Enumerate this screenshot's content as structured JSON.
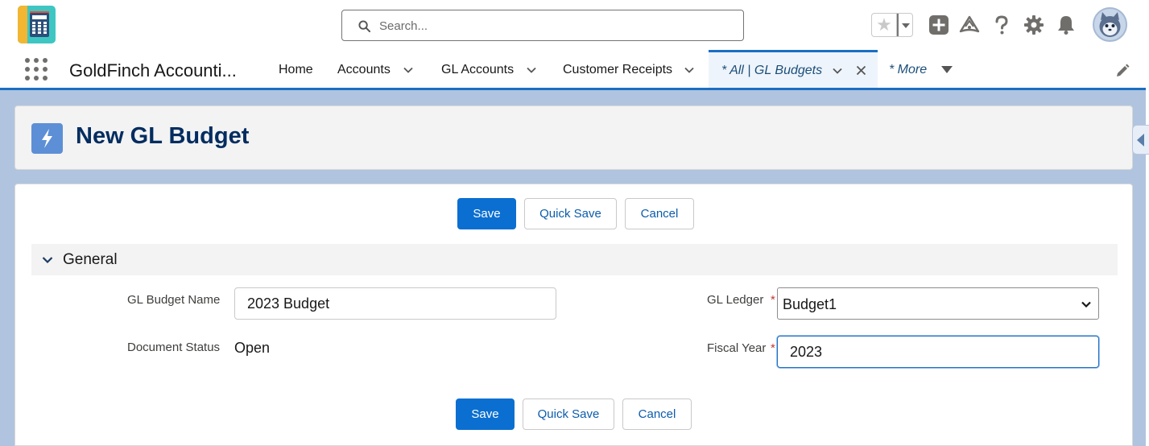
{
  "header": {
    "app_logo_text": "GoldFinch",
    "search_placeholder": "Search...",
    "icons": [
      "favorites-star-icon",
      "favorites-dropdown-icon",
      "add-icon",
      "trailhead-icon",
      "help-icon",
      "setup-gear-icon",
      "notifications-bell-icon",
      "user-avatar"
    ]
  },
  "nav": {
    "app_name": "GoldFinch Accounti...",
    "tabs": [
      {
        "label": "Home",
        "has_menu": false
      },
      {
        "label": "Accounts",
        "has_menu": true
      },
      {
        "label": "GL Accounts",
        "has_menu": true
      },
      {
        "label": "Customer Receipts",
        "has_menu": true
      },
      {
        "label": "* All | GL Budgets",
        "has_menu": true,
        "active": true,
        "closable": true
      }
    ],
    "more_label": "* More"
  },
  "page": {
    "title": "New GL Budget",
    "icon": "lightning-bolt-icon"
  },
  "form": {
    "buttons": {
      "save": "Save",
      "quick_save": "Quick Save",
      "cancel": "Cancel"
    },
    "section_title": "General",
    "fields": {
      "budget_name": {
        "label": "GL Budget Name",
        "value": "2023 Budget"
      },
      "document_status": {
        "label": "Document Status",
        "value": "Open"
      },
      "gl_ledger": {
        "label": "GL Ledger",
        "required_mark": "*",
        "value": "Budget1"
      },
      "fiscal_year": {
        "label": "Fiscal Year",
        "required_mark": "*",
        "value": "2023"
      }
    }
  },
  "colors": {
    "brand_blue": "#0b6fd1",
    "nav_accent": "#1b6ec2",
    "title_navy": "#032d60",
    "required_red": "#c23934",
    "background": "#b0c4df"
  }
}
